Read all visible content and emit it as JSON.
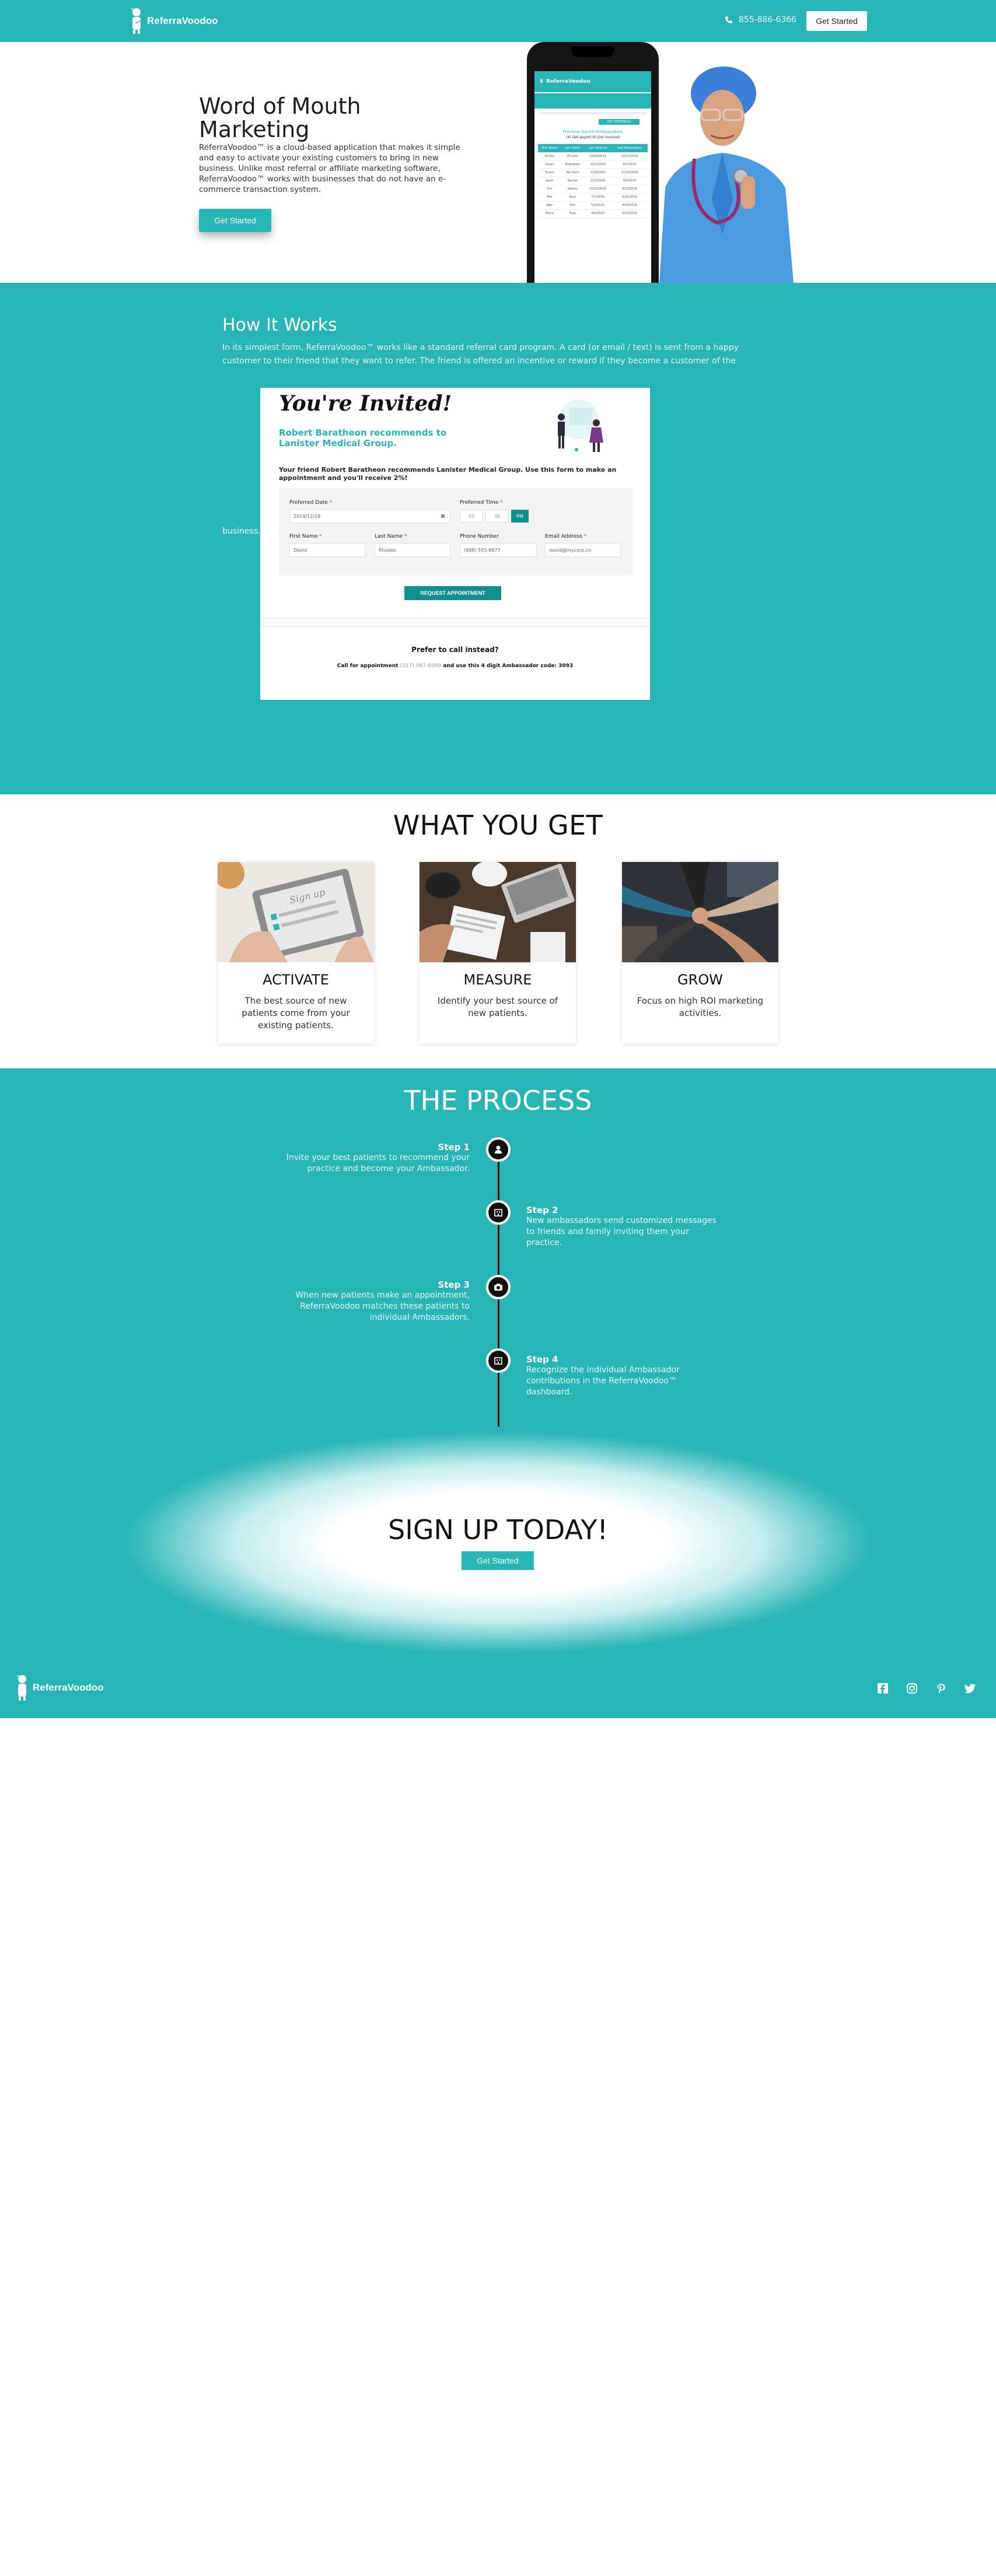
{
  "navbar": {
    "brand": "ReferraVoodoo",
    "phone": "855-886-6366",
    "cta": "Get Started"
  },
  "hero": {
    "title": "Word of Mouth Marketing",
    "text": "ReferraVoodoo™ is a cloud-based application that makes it simple and easy to activate your existing customers to bring in new business. Unlike most referral or affiliate marketing software, ReferraVoodoo™ works with businesses that do not have an e-commerce transaction system.",
    "cta": "Get Started",
    "phone_screen": {
      "brand": "ReferraVoodoo",
      "button": "GET REFERRALS",
      "title": "Previous Saved Ambassadors",
      "meta": "(4) Get payed (4) Get invoiced",
      "columns": [
        "First Name",
        "Last Name",
        "Last Referral",
        "Last Redemption"
      ],
      "rows": [
        [
          "Ashley",
          "Rhodes",
          "12/16/2019",
          "12/11/2019"
        ],
        [
          "Susan",
          "Rodriguez",
          "12/1/2019",
          "8/1/2019"
        ],
        [
          "Tucker",
          "Van Horn",
          "11/8/2019",
          "11/24/2019"
        ],
        [
          "Jason",
          "Barnes",
          "11/1/2019",
          "9/9/2019"
        ],
        [
          "Tim",
          "Adams",
          "10/20/2019",
          "8/13/2019"
        ],
        [
          "Mel",
          "Bass",
          "7/7/2019",
          "6/20/2019"
        ],
        [
          "Jake",
          "Kim",
          "5/3/2019",
          "4/19/2019"
        ],
        [
          "Maria",
          "Tuan",
          "4/4/2019",
          "3/16/2019"
        ]
      ]
    }
  },
  "how": {
    "title": "How It Works",
    "text": "In its simplest form, ReferraVoodoo™ works like a standard referral card program. A card (or email / text) is sent from a happy customer to their friend that they want to refer. The friend is offered an incentive or reward if they become a customer of the",
    "text_tail": "business.",
    "invite": {
      "title": "You're Invited!",
      "recommend": "Robert Baratheon recommends to Lanister Medical Group.",
      "message": "Your friend Robert Baratheon recommends Lanister Medical Group. Use this form to make an appointment and you'll receive 2%!",
      "labels": {
        "date": "Preferred Date",
        "time": "Preferred Time",
        "first": "First Name",
        "last": "Last Name",
        "phone": "Phone Number",
        "email": "Email Address"
      },
      "values": {
        "date": "2019/12/18",
        "hour": "10",
        "minute": "30",
        "ampm": "PM",
        "first": "David",
        "last": "Rhodes",
        "phone": "(888) 555-8877",
        "email": "david@mycorp.co"
      },
      "request_button": "REQUEST APPOINTMENT",
      "call_title": "Prefer to call instead?",
      "call_prefix": "Call for appointment",
      "call_phone": "(317) 567-6099",
      "call_suffix": "and use this 4 digit Ambassador code: 3093"
    }
  },
  "wyg": {
    "title": "WHAT YOU GET",
    "cards": [
      {
        "title": "ACTIVATE",
        "desc": "The best source of new patients come from your existing patients."
      },
      {
        "title": "MEASURE",
        "desc": "Identify your best source of new patients."
      },
      {
        "title": "GROW",
        "desc": "Focus on high ROI marketing activities."
      }
    ]
  },
  "process": {
    "title": "THE PROCESS",
    "steps": [
      {
        "label": "Step 1",
        "desc": "Invite your best patients to recommend your practice and become your Ambassador."
      },
      {
        "label": "Step 2",
        "desc": "New ambassadors send customized messages to friends and family inviting them your practice."
      },
      {
        "label": "Step 3",
        "desc": "When new patients make an appointment, ReferraVoodoo matches these patients to individual Ambassadors."
      },
      {
        "label": "Step 4",
        "desc": "Recognize the individual Ambassador contributions in the ReferraVoodoo™ dashboard."
      }
    ]
  },
  "signup": {
    "title": "SIGN UP TODAY!",
    "cta": "Get Started"
  },
  "footer": {
    "brand": "ReferraVoodoo",
    "social": [
      "facebook-icon",
      "instagram-icon",
      "pinterest-icon",
      "twitter-icon"
    ]
  },
  "colors": {
    "brand": "#28b5b5",
    "accent_dark": "#129090"
  }
}
